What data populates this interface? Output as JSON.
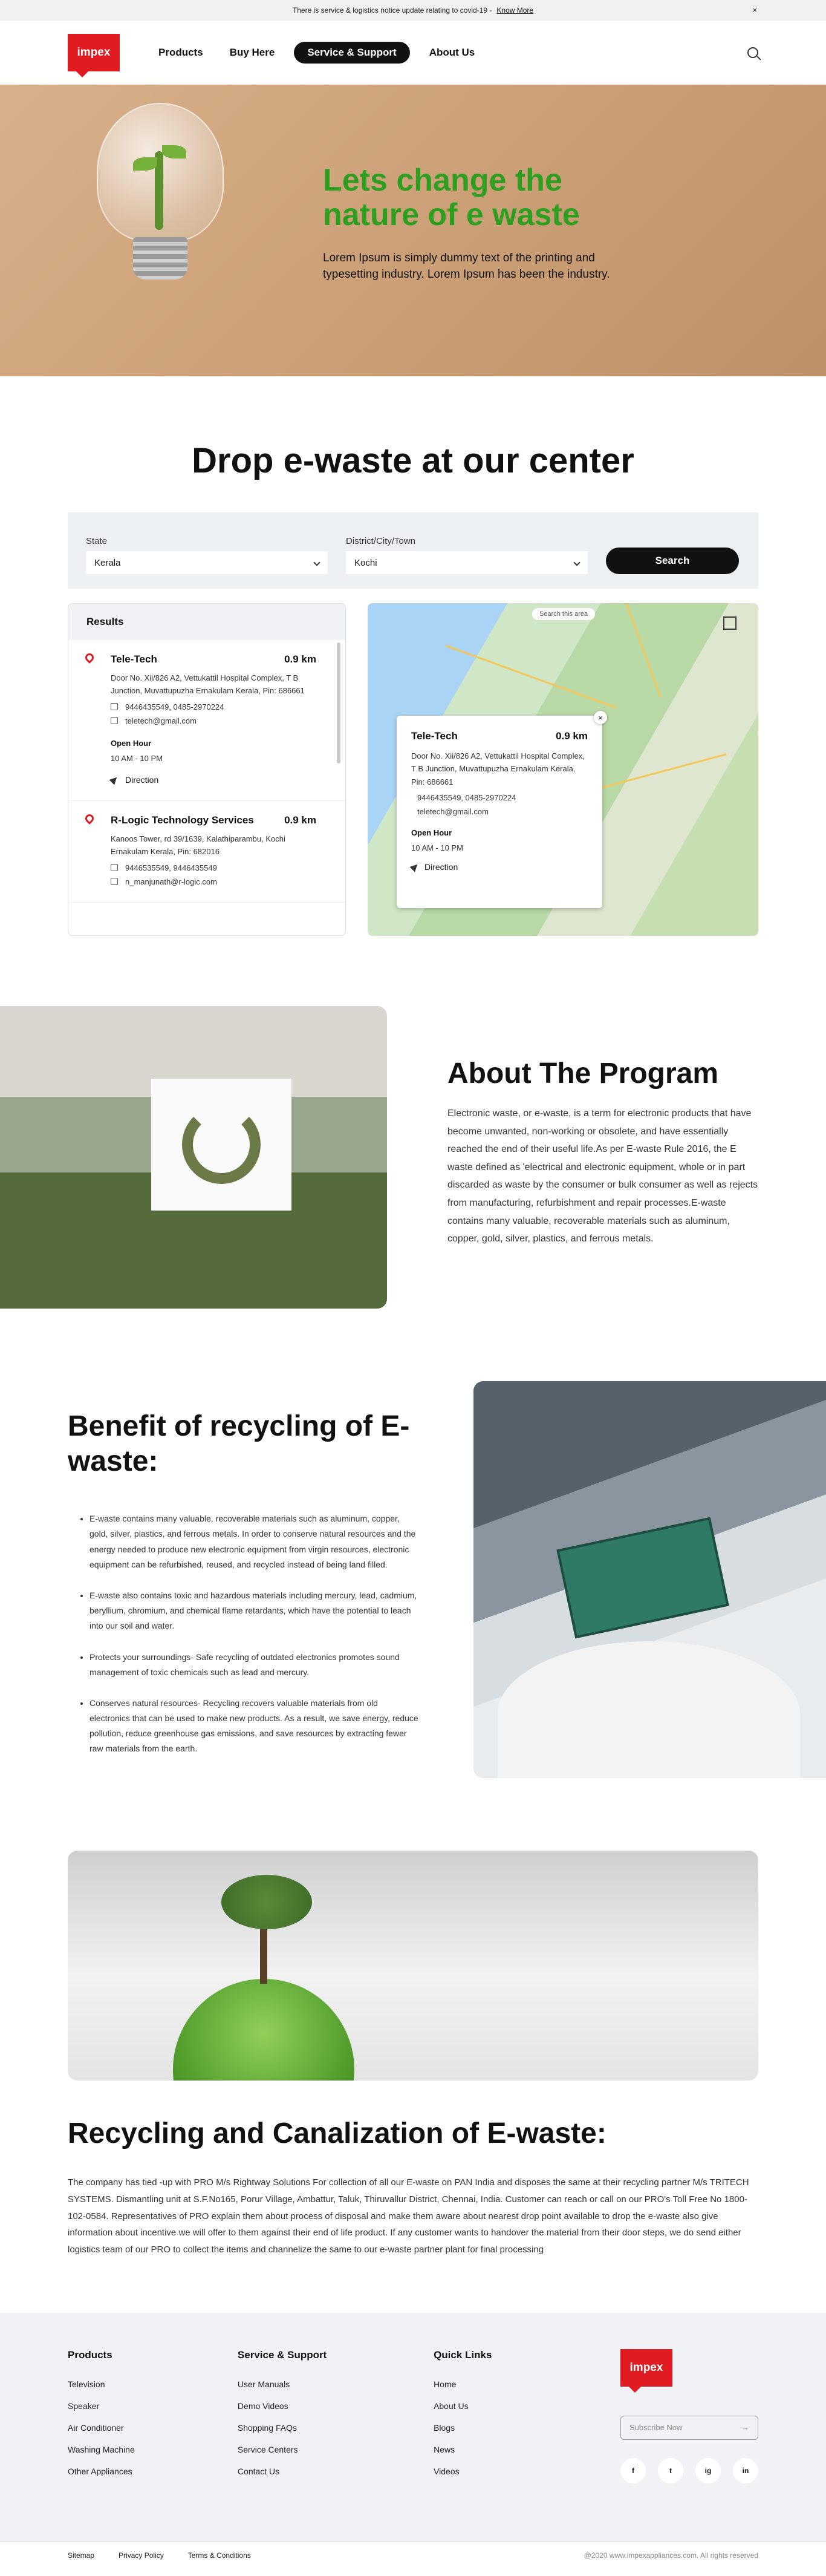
{
  "notice": {
    "text": "There is service & logistics notice update relating to covid-19 -",
    "link": "Know More",
    "close": "×"
  },
  "brand": {
    "logo_text": "impex",
    "accent": "#e01b22",
    "hero_green": "#2e9e1e"
  },
  "nav": {
    "items": [
      "Products",
      "Buy Here",
      "Service & Support",
      "About Us"
    ],
    "active": "Service & Support"
  },
  "hero": {
    "title": "Lets change the nature of e waste",
    "text": "Lorem Ipsum is simply dummy text of the printing and typesetting industry. Lorem Ipsum has been the industry."
  },
  "drop": {
    "title": "Drop e-waste at our center",
    "state_label": "State",
    "state_value": "Kerala",
    "city_label": "District/City/Town",
    "city_value": "Kochi",
    "search_button": "Search",
    "results_title": "Results"
  },
  "locations": [
    {
      "name": "Tele-Tech",
      "distance": "0.9 km",
      "address": "Door No. Xii/826 A2, Vettukattil Hospital Complex, T B Junction, Muvattupuzha Ernakulam Kerala, Pin: 686661",
      "phone": "9446435549, 0485-2970224",
      "email": "teletech@gmail.com",
      "open_label": "Open Hour",
      "hours": "10 AM - 10 PM",
      "direction": "Direction"
    },
    {
      "name": "R-Logic Technology Services",
      "distance": "0.9 km",
      "address": "Kanoos Tower, rd 39/1639, Kalathiparambu, Kochi Ernakulam Kerala, Pin: 682016",
      "phone": "9446535549, 9446435549",
      "email": "n_manjunath@r-logic.com"
    }
  ],
  "map": {
    "search_placeholder": "Search this area",
    "popup": {
      "name": "Tele-Tech",
      "distance": "0.9 km",
      "address": "Door No. Xii/826 A2, Vettukattil Hospital Complex, T B Junction, Muvattupuzha Ernakulam Kerala, Pin: 686661",
      "phone": "9446435549, 0485-2970224",
      "email": "teletech@gmail.com",
      "open_label": "Open Hour",
      "hours": "10 AM - 10 PM",
      "direction": "Direction",
      "close": "×"
    }
  },
  "about": {
    "title": "About The Program",
    "text": "Electronic waste, or e-waste, is a term for electronic products that have become unwanted, non-working or obsolete, and have essentially reached the end of their useful life.As per E-waste Rule 2016, the E waste defined as 'electrical and electronic equipment, whole or in part discarded as waste by the consumer or bulk consumer as well as rejects from manufacturing, refurbishment and repair processes.E-waste contains many valuable, recoverable materials such as aluminum, copper, gold, silver, plastics, and ferrous metals."
  },
  "benefit": {
    "title": "Benefit of recycling of E-waste:",
    "items": [
      "E-waste contains many valuable, recoverable materials such as aluminum, copper, gold, silver, plastics, and ferrous metals. In order to conserve natural resources and the energy needed to produce new electronic equipment from virgin resources, electronic equipment can be refurbished, reused, and recycled instead of being land filled.",
      "E-waste also contains toxic and hazardous materials including mercury, lead, cadmium, beryllium, chromium, and chemical flame retardants, which have the potential to leach into our soil and water.",
      "Protects your surroundings- Safe recycling of outdated electronics promotes sound management of toxic chemicals such as lead and mercury.",
      "Conserves natural resources- Recycling recovers valuable materials from old electronics that can be used to make new products. As a result, we save energy, reduce pollution, reduce greenhouse gas emissions, and save resources by extracting fewer raw materials from the earth."
    ]
  },
  "canal": {
    "title": "Recycling and Canalization of E-waste:",
    "text": "The company has tied -up with PRO M/s Rightway Solutions For collection of all our E-waste on PAN India and disposes the same at their recycling partner M/s TRITECH SYSTEMS. Dismantling unit at S.F.No165, Porur Village, Ambattur, Taluk, Thiruvallur District, Chennai, India. Customer can reach or call on our PRO's Toll Free No 1800-102-0584. Representatives of PRO explain them about process of disposal and make them aware about nearest drop point available to drop the e-waste also give information about incentive we will offer to them against their end of life product. If any customer wants to handover the material from their door steps, we do send either logistics team of our PRO to collect the items and channelize the same to our e-waste partner plant for final processing"
  },
  "footer": {
    "products": {
      "title": "Products",
      "links": [
        "Television",
        "Speaker",
        "Air Conditioner",
        "Washing Machine",
        "Other Appliances"
      ]
    },
    "service": {
      "title": "Service & Support",
      "links": [
        "User Manuals",
        "Demo Videos",
        "Shopping FAQs",
        "Service Centers",
        "Contact Us"
      ]
    },
    "quick": {
      "title": "Quick Links",
      "links": [
        "Home",
        "About Us",
        "Blogs",
        "News",
        "Videos"
      ]
    },
    "subscribe_placeholder": "Subscribe Now",
    "socials": [
      "f",
      "t",
      "ig",
      "in"
    ],
    "bottom_links": [
      "Sitemap",
      "Privacy Policy",
      "Terms & Conditions"
    ],
    "copyright": "@2020 www.impexappliances.com. All rights reserved"
  }
}
